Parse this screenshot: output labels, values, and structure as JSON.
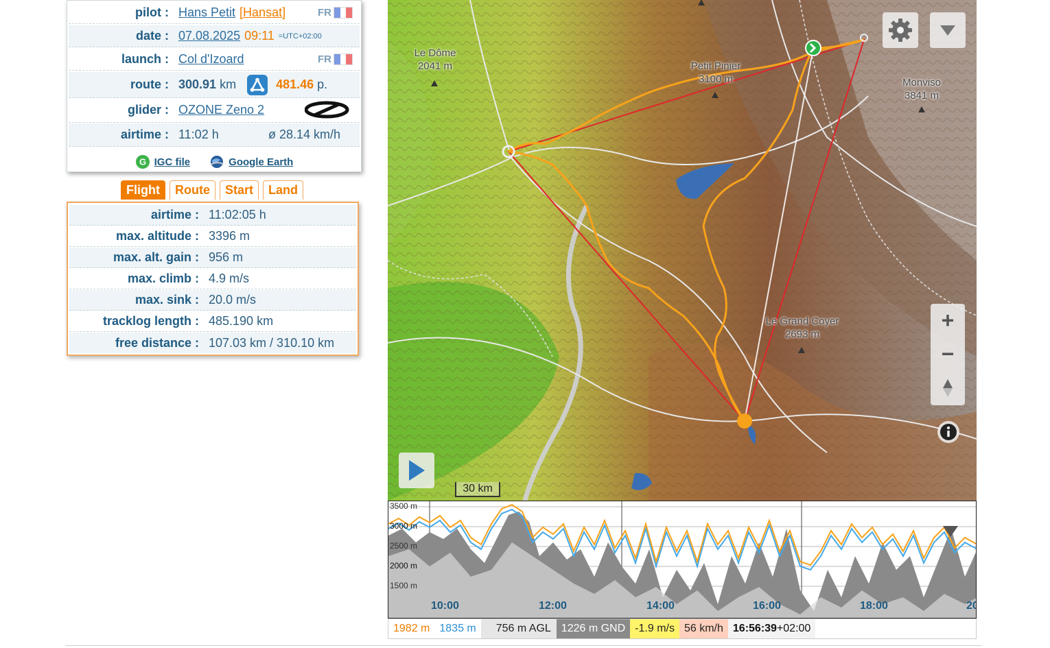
{
  "info": {
    "pilot_label": "pilot :",
    "pilot_name": "Hans Petit",
    "pilot_club": "[Hansat]",
    "country": "FR",
    "date_label": "date :",
    "date": "07.08.2025",
    "time": "09:11",
    "tz": "=UTC+02:00",
    "launch_label": "launch :",
    "launch": "Col d'Izoard",
    "launch_country": "FR",
    "route_label": "route :",
    "route_km": "300.91",
    "route_unit": "km",
    "points": "481.46",
    "points_unit": "p.",
    "glider_label": "glider :",
    "glider": "OZONE Zeno 2",
    "airtime_label": "airtime :",
    "airtime": "11:02 h",
    "avg_speed": "ø 28.14 km/h",
    "igc_link": "IGC file",
    "ge_link": "Google Earth"
  },
  "tabs": [
    "Flight",
    "Route",
    "Start",
    "Land"
  ],
  "stats": [
    {
      "label": "airtime :",
      "value": "11:02:05 h"
    },
    {
      "label": "max. altitude :",
      "value": "3396 m"
    },
    {
      "label": "max. alt. gain :",
      "value": "956 m"
    },
    {
      "label": "max. climb :",
      "value": "4.9 m/s"
    },
    {
      "label": "max. sink :",
      "value": "20.0 m/s"
    },
    {
      "label": "tracklog length :",
      "value": "485.190 km"
    },
    {
      "label": "free distance :",
      "value": "107.03 km / 310.10 km"
    }
  ],
  "map": {
    "labels": [
      {
        "name": "Le Dôme",
        "alt": "2041 m"
      },
      {
        "name": "Petit Pinier",
        "alt": "3100 m"
      },
      {
        "name": "Monviso",
        "alt": "3841 m"
      },
      {
        "name": "Le Grand Coyer",
        "alt": "2693 m"
      }
    ],
    "scale": "30 km",
    "zoom_in": "+",
    "zoom_out": "−"
  },
  "profile": {
    "y_ticks": [
      "3500 m",
      "3000 m",
      "2500 m",
      "2000 m",
      "1500 m"
    ],
    "x_ticks": [
      "10:00",
      "12:00",
      "14:00",
      "16:00",
      "18:00",
      "20"
    ]
  },
  "status": {
    "alt_gps": "1982 m",
    "alt_baro": "1835 m",
    "agl": "756 m AGL",
    "gnd": "1226 m GND",
    "vario": "-1.9 m/s",
    "speed": "56 km/h",
    "time": "16:56:39",
    "tz": "+02:00"
  },
  "colors": {
    "accent": "#f07d00",
    "label_blue": "#1f5b82",
    "track": "#f7a21b",
    "triangle": "#e0262b",
    "baro_line": "#45a9e8"
  }
}
